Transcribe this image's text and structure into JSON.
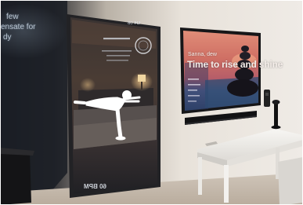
{
  "wall_projection": {
    "lines": [
      "few",
      "ensate for",
      "dy"
    ]
  },
  "smart_mirror": {
    "top_value": "ᗡ4 08",
    "heart_rate": "60 BPM"
  },
  "tv_screen": {
    "greeting": "Sanna, dew",
    "headline": "Time to rise and shine"
  },
  "colors": {
    "wall": "#e7e2db",
    "mirror_frame": "#2b2a2c",
    "tv_sky_top": "#d27868",
    "tv_sea": "#3d5d84",
    "silhouette": "#ffffff"
  }
}
